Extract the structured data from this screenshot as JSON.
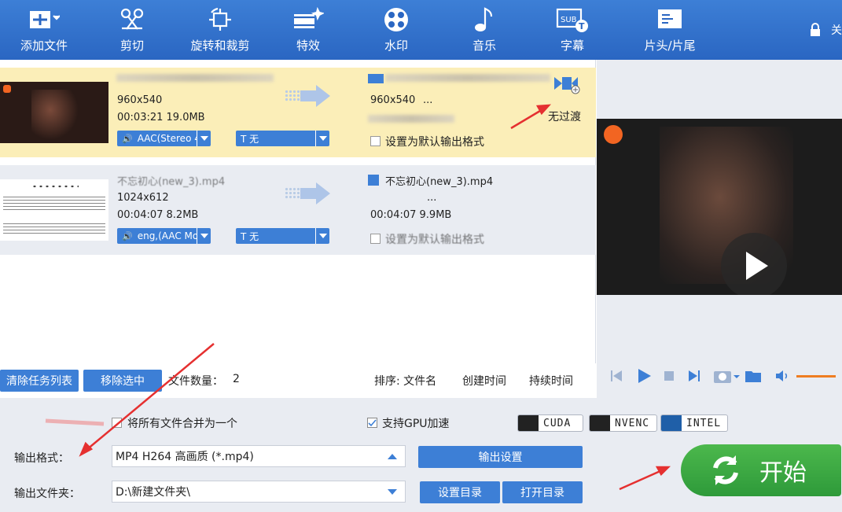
{
  "toolbar": {
    "items": [
      {
        "label": "添加文件",
        "icon": "add-file-icon"
      },
      {
        "label": "剪切",
        "icon": "scissors-icon"
      },
      {
        "label": "旋转和裁剪",
        "icon": "rotate-crop-icon"
      },
      {
        "label": "特效",
        "icon": "effects-icon"
      },
      {
        "label": "水印",
        "icon": "watermark-icon"
      },
      {
        "label": "音乐",
        "icon": "music-icon"
      },
      {
        "label": "字幕",
        "icon": "subtitle-icon"
      },
      {
        "label": "片头/片尾",
        "icon": "intro-outro-icon"
      }
    ],
    "right_label": "关"
  },
  "files": [
    {
      "src_res": "960x540",
      "src_info": "00:03:21  19.0MB",
      "audio": "AAC(Stereo 4",
      "subtitle": "T 无",
      "out_res": "960x540",
      "out_ellipsis": "...",
      "transition": "无过渡",
      "default_format": "设置为默认输出格式",
      "selected": true
    },
    {
      "src_name": "不忘初心(new_3).mp4",
      "src_res": "1024x612",
      "src_info": "00:04:07  8.2MB",
      "audio": "eng,(AAC Mo",
      "subtitle": "T 无",
      "out_name": "不忘初心(new_3).mp4",
      "out_ellipsis": "...",
      "out_info": "00:04:07  9.9MB",
      "default_format": "设置为默认输出格式",
      "selected": false
    }
  ],
  "listbar": {
    "clear": "清除任务列表",
    "remove": "移除选中",
    "count_label": "文件数量：",
    "count": "2",
    "sort_label": "排序: 文件名",
    "sort_created": "创建时间",
    "sort_duration": "持续时间"
  },
  "settings": {
    "merge": "将所有文件合并为一个",
    "gpu": "支持GPU加速",
    "gpu_badges": [
      "CUDA",
      "NVENC",
      "INTEL"
    ],
    "format_label": "输出格式：",
    "format_value": "MP4  H264 高画质 (*.mp4)",
    "output_settings": "输出设置",
    "folder_label": "输出文件夹：",
    "folder_value": "D:\\新建文件夹\\",
    "set_dir": "设置目录",
    "open_dir": "打开目录",
    "start": "开始"
  },
  "colors": {
    "toolbar": "#3d7fd6",
    "selected_row": "#fbeeb8",
    "start_green": "#3aa843",
    "annotation_red": "#e53030"
  }
}
